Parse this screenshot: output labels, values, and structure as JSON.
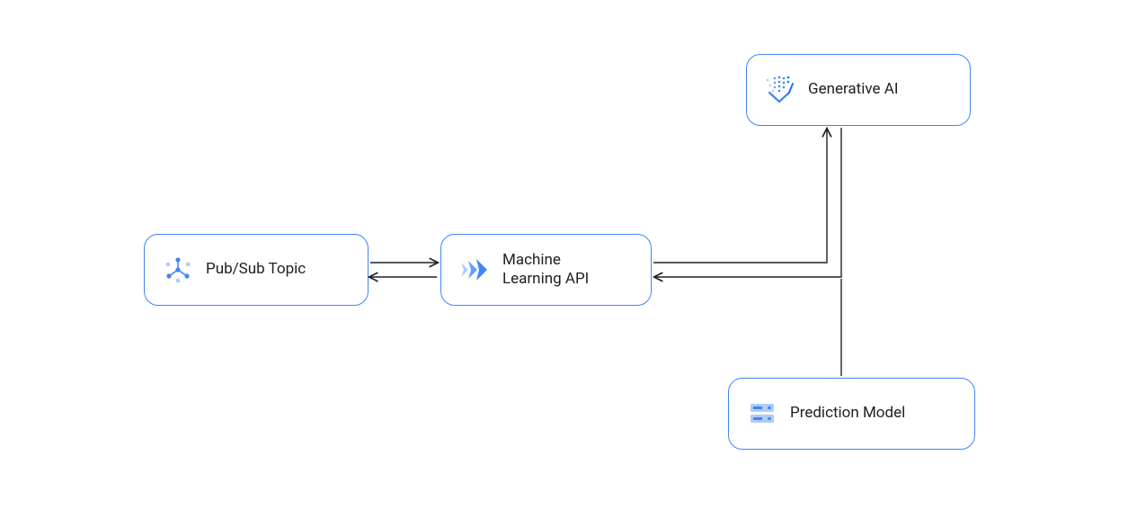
{
  "nodes": {
    "pubsub": {
      "label": "Pub/Sub Topic"
    },
    "ml_api": {
      "label": "Machine\nLearning API"
    },
    "genai": {
      "label": "Generative AI"
    },
    "prediction": {
      "label": "Prediction Model"
    }
  },
  "colors": {
    "node_border": "#4285f4",
    "arrow": "#202124",
    "icon_light": "#aecbfa",
    "icon_dark": "#4285f4"
  }
}
